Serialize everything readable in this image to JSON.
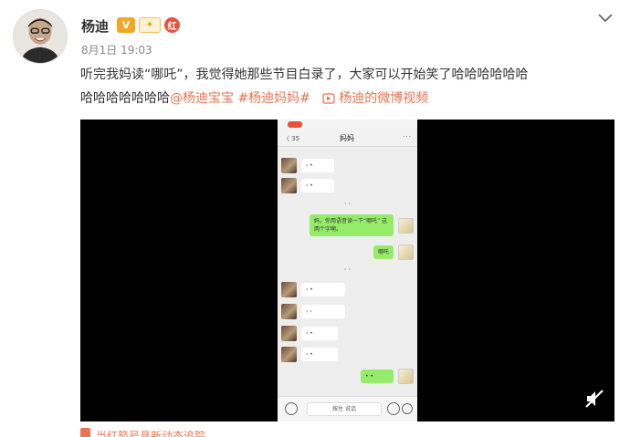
{
  "post": {
    "username": "杨迪",
    "badges": {
      "verified": "V",
      "gold": "✦",
      "red": "红"
    },
    "timestamp": "8月1日 19:03",
    "text_before_quote": "听完我妈读",
    "quote": "“哪吒”",
    "text_after_quote": "，我觉得她那些节目白录了，大家可以开始笑了哈哈哈哈哈哈",
    "text_line2": "哈哈哈哈哈哈哈",
    "mention": "@杨迪宝宝",
    "hashtag": "#杨迪妈妈#",
    "video_link": "杨迪的微博视频"
  },
  "video": {
    "chat_title": "妈妈",
    "back_label": "〈 35",
    "more_label": "···",
    "messages": [
      {
        "side": "left",
        "text": "‹ •"
      },
      {
        "side": "left",
        "text": "‹ •"
      },
      {
        "side": "right",
        "text": "妈，你用语音读一下“哪吒” 这两个字啊。"
      },
      {
        "side": "right",
        "text": "哪吒"
      },
      {
        "side": "left",
        "text": "‹ •"
      },
      {
        "side": "left",
        "text": "‹ ›"
      },
      {
        "side": "left",
        "text": "‹ •"
      },
      {
        "side": "left",
        "text": "‹ •"
      },
      {
        "side": "right",
        "text": "• •"
      }
    ],
    "timestamps": [
      "• •",
      "• •"
    ],
    "input_placeholder": "按住 说话"
  },
  "footer": {
    "text": "当红箭号具新动态追踪"
  },
  "colors": {
    "link": "#eb7350",
    "chat_green": "#95ec69",
    "verified": "#f5a623"
  },
  "icons": {
    "more": "chevron-down-icon",
    "video": "video-play-icon",
    "mute": "mute-icon"
  }
}
